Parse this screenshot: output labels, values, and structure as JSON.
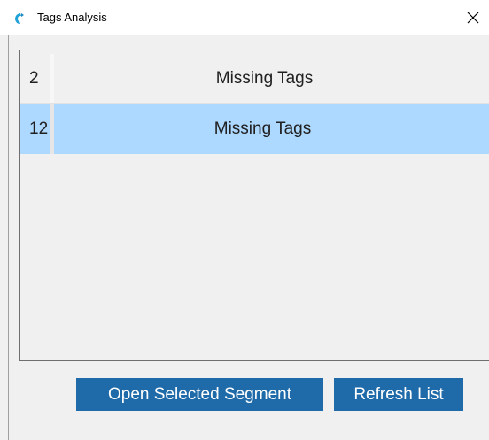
{
  "window": {
    "title": "Tags Analysis",
    "close_symbol": "✕"
  },
  "icons": {
    "app": "app-logo-icon",
    "close": "close-icon"
  },
  "list": {
    "rows": [
      {
        "number": "2",
        "description": "Missing Tags",
        "selected": false
      },
      {
        "number": "12",
        "description": "Missing Tags",
        "selected": true
      }
    ]
  },
  "buttons": {
    "open_selected": "Open Selected Segment",
    "refresh": "Refresh List"
  },
  "colors": {
    "selection": "#add8ff",
    "button": "#1f6aa8",
    "background": "#f0f0f0"
  }
}
